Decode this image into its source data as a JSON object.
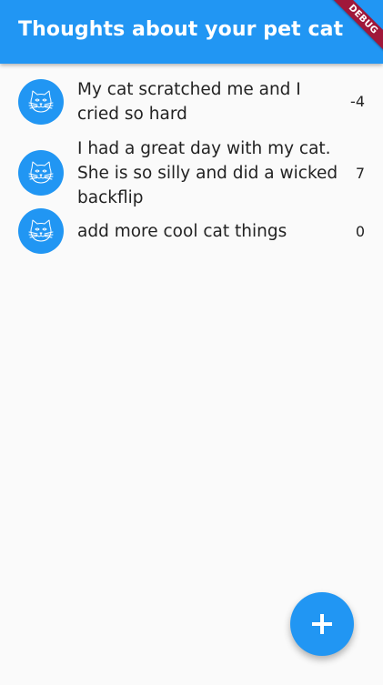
{
  "app_bar": {
    "title": "Thoughts about your pet cat",
    "background_color": "#2196f3"
  },
  "debug_banner": {
    "label": "DEBUG",
    "color": "#a0183a"
  },
  "thoughts": [
    {
      "avatar_icon": "cat-face-icon",
      "text": "My cat scratched me and I cried so hard",
      "score": "-4"
    },
    {
      "avatar_icon": "cat-face-icon",
      "text": "I had a great day with my cat. She is so silly and did a wicked backflip",
      "score": "7"
    },
    {
      "avatar_icon": "cat-face-icon",
      "text": "add more cool cat things",
      "score": "0"
    }
  ],
  "fab": {
    "icon": "plus-icon"
  }
}
